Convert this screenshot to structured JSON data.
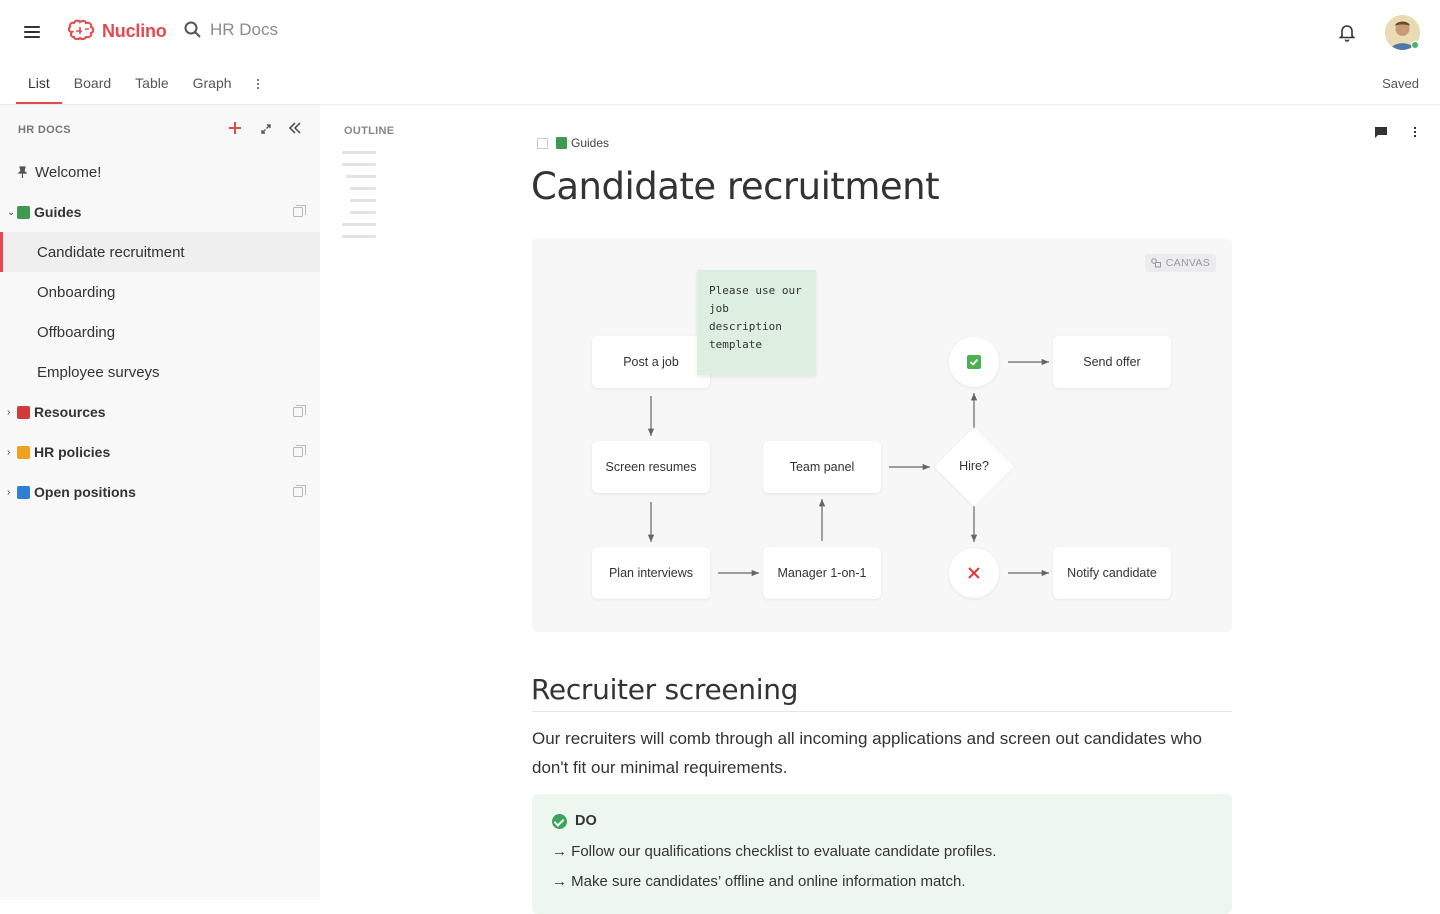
{
  "app": {
    "name": "Nuclino",
    "workspace": "HR Docs"
  },
  "header": {
    "search_placeholder": "HR Docs",
    "status": "Saved"
  },
  "tabs": [
    {
      "label": "List",
      "active": true
    },
    {
      "label": "Board"
    },
    {
      "label": "Table"
    },
    {
      "label": "Graph"
    }
  ],
  "sidebar": {
    "heading": "HR DOCS",
    "items": [
      {
        "label": "Welcome!",
        "type": "pinned"
      },
      {
        "label": "Guides",
        "type": "collection",
        "expanded": true,
        "color": "#3d9a4f"
      },
      {
        "label": "Candidate recruitment",
        "type": "child",
        "selected": true
      },
      {
        "label": "Onboarding",
        "type": "child"
      },
      {
        "label": "Offboarding",
        "type": "child"
      },
      {
        "label": "Employee surveys",
        "type": "child"
      },
      {
        "label": "Resources",
        "type": "collection",
        "color": "#d23b3b"
      },
      {
        "label": "HR policies",
        "type": "collection",
        "color": "#f0a020"
      },
      {
        "label": "Open positions",
        "type": "collection",
        "color": "#2f7fd0"
      }
    ]
  },
  "outline": {
    "label": "OUTLINE"
  },
  "document": {
    "breadcrumb": "Guides",
    "title": "Candidate recruitment",
    "canvas": {
      "badge": "CANVAS",
      "sticky_note": "Please use our job description template",
      "nodes": {
        "post_job": "Post a job",
        "screen_resumes": "Screen resumes",
        "plan_interviews": "Plan interviews",
        "manager_1on1": "Manager 1-on-1",
        "team_panel": "Team panel",
        "hire": "Hire?",
        "send_offer": "Send offer",
        "notify_candidate": "Notify candidate"
      }
    },
    "section_heading": "Recruiter screening",
    "paragraph": "Our recruiters will comb through all incoming applications and screen out candidates who don't fit our minimal requirements.",
    "callout": {
      "heading": "DO",
      "lines": [
        "→ Follow our qualifications checklist to evaluate candidate profiles.",
        "→ Make sure candidates’ offline and online information match."
      ]
    }
  },
  "colors": {
    "accent": "#e5484d",
    "success": "#3aa35a",
    "callout_bg": "#eef6f0"
  }
}
